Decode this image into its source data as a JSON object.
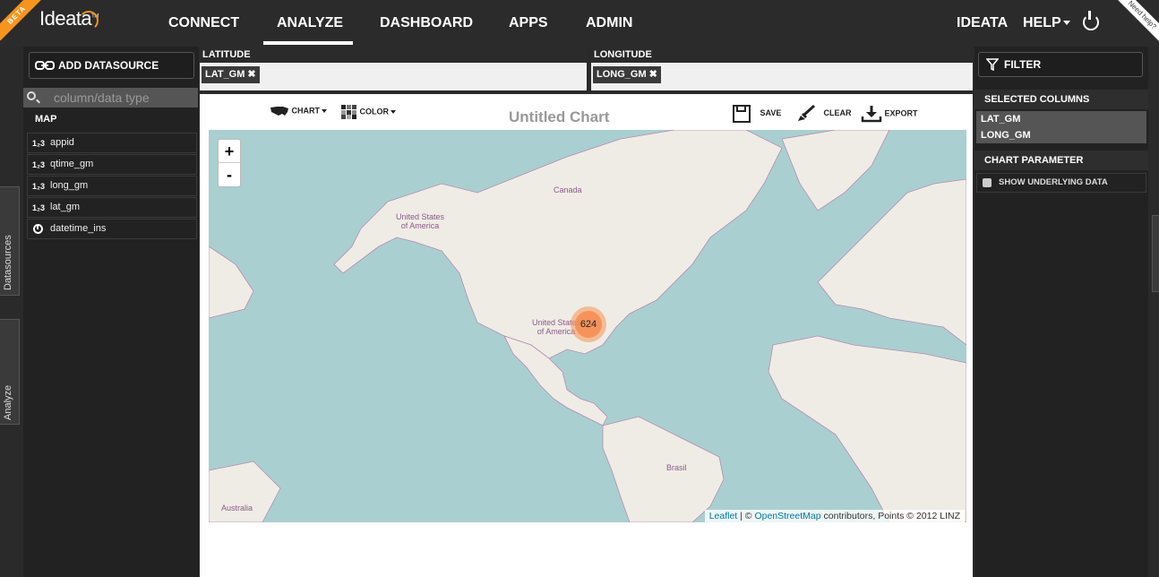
{
  "app": {
    "beta_ribbon": "BETA",
    "help_ribbon": "Need help?",
    "logo_text": "Ideata",
    "logo_tm": "TM"
  },
  "nav": {
    "items": [
      "CONNECT",
      "ANALYZE",
      "DASHBOARD",
      "APPS",
      "ADMIN"
    ],
    "active": "ANALYZE",
    "user": "IDEATA",
    "help": "HELP"
  },
  "left_tabs": [
    "Datasources",
    "Analyze"
  ],
  "datasource_panel": {
    "add_label": "ADD DATASOURCE",
    "search_placeholder": "column/data type",
    "section_label": "MAP",
    "columns": [
      {
        "name": "appid",
        "type": "number"
      },
      {
        "name": "qtime_gm",
        "type": "number"
      },
      {
        "name": "long_gm",
        "type": "number"
      },
      {
        "name": "lat_gm",
        "type": "number"
      },
      {
        "name": "datetime_ins",
        "type": "datetime"
      }
    ],
    "number_type_glyph": "1₂3"
  },
  "dropzones": {
    "latitude": {
      "label": "LATITUDE",
      "chip": "LAT_GM"
    },
    "longitude": {
      "label": "LONGITUDE",
      "chip": "LONG_GM"
    },
    "remove_glyph": "✖"
  },
  "chart": {
    "toolbar": {
      "chart_label": "CHART",
      "color_label": "COLOR",
      "save_label": "SAVE",
      "clear_label": "CLEAR",
      "export_label": "EXPORT"
    },
    "title": "Untitled Chart",
    "zoom_in": "+",
    "zoom_out": "-",
    "cluster_count": "624",
    "map_labels": {
      "canada": "Canada",
      "usa_alaska": "United States of America",
      "usa_main": "United States of America",
      "brazil": "Brasil",
      "australia": "Australia"
    },
    "attribution": {
      "leaflet": "Leaflet",
      "sep": " | © ",
      "osm": "OpenStreetMap",
      "rest": " contributors, Points © 2012 LINZ"
    }
  },
  "right_panel": {
    "filter_label": "FILTER",
    "selected_title": "SELECTED COLUMNS",
    "selected": [
      "LAT_GM",
      "LONG_GM"
    ],
    "param_title": "CHART PARAMETER",
    "show_data_label": "SHOW UNDERLYING DATA",
    "show_data_checked": false
  },
  "colors": {
    "accent": "#f7941d",
    "dark_bg": "#2b2b2b",
    "water": "#aacfd0",
    "land": "#efece5",
    "border": "#b58cb5"
  }
}
